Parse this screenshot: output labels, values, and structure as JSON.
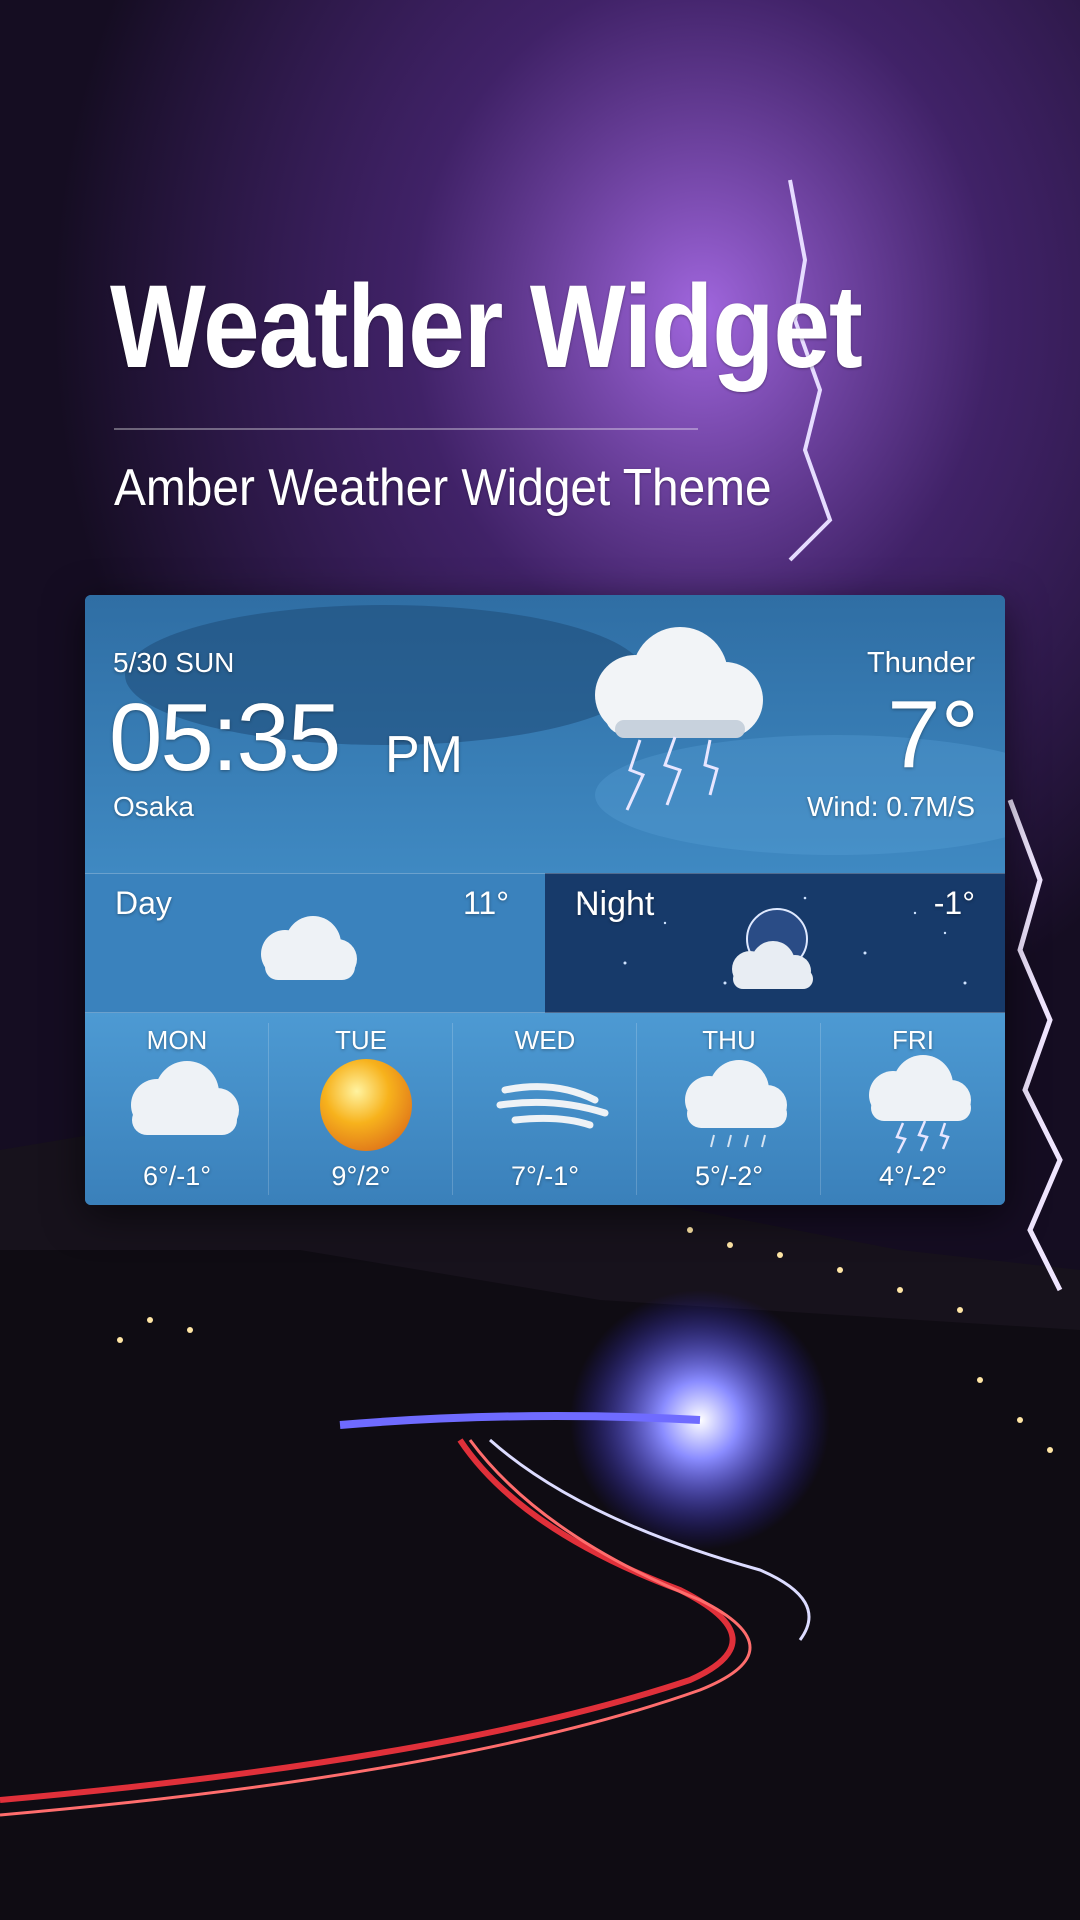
{
  "headline": "Weather Widget",
  "subhead": "Amber Weather Widget Theme",
  "widget": {
    "date": "5/30 SUN",
    "time": "05:35",
    "ampm": "PM",
    "city": "Osaka",
    "condition": "Thunder",
    "temperature": "7°",
    "wind": "Wind: 0.7M/S",
    "day": {
      "label": "Day",
      "temp": "11°"
    },
    "night": {
      "label": "Night",
      "temp": "-1°"
    },
    "forecast": [
      {
        "day": "MON",
        "range": "6°/-1°",
        "icon": "cloudy-icon"
      },
      {
        "day": "TUE",
        "range": "9°/2°",
        "icon": "sun-icon"
      },
      {
        "day": "WED",
        "range": "7°/-1°",
        "icon": "wind-icon"
      },
      {
        "day": "THU",
        "range": "5°/-2°",
        "icon": "rain-icon"
      },
      {
        "day": "FRI",
        "range": "4°/-2°",
        "icon": "thunderstorm-icon"
      }
    ]
  },
  "colors": {
    "sky": "#3b7fb8",
    "night": "#173a6a",
    "storm_glow": "#9b5be0",
    "sun": "#f7b21c"
  }
}
